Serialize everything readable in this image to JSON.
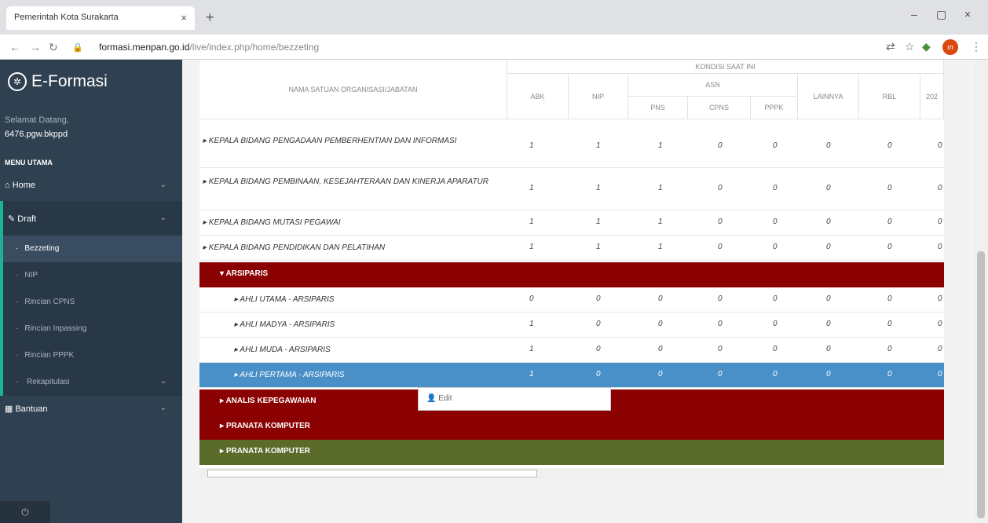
{
  "browser": {
    "tab_title": "Pemerintah Kota Surakarta",
    "tab_close": "×",
    "new_tab": "+",
    "minimize": "–",
    "maximize": "▢",
    "close": "×",
    "url_host": "formasi.menpan.go.id",
    "url_path": "/live/index.php/home/bezzeting",
    "profile_initial": "m"
  },
  "sidebar": {
    "brand": "E-Formasi",
    "welcome": "Selamat Datang,",
    "user": "6476.pgw.bkppd",
    "menu_header": "MENU UTAMA",
    "items": {
      "home": "Home",
      "draft": "Draft",
      "bantuan": "Bantuan"
    },
    "draft_subitems": [
      "Bezzeting",
      "NIP",
      "Rincian CPNS",
      "Rincian Inpassing",
      "Rincian PPPK",
      "Rekapitulasi"
    ]
  },
  "table": {
    "headers": {
      "name": "NAMA SATUAN ORGANISASI/JABATAN",
      "kondisi": "KONDISI SAAT INI",
      "abk": "ABK",
      "nip": "NIP",
      "asn": "ASN",
      "pns": "PNS",
      "cpns": "CPNS",
      "pppk": "PPPK",
      "lainnya": "LAINNYA",
      "rbl": "RBL",
      "next": "202"
    },
    "rows": [
      {
        "name": "▸ KEPALA BIDANG PENGADAAN PEMBERHENTIAN DAN INFORMASI",
        "values": [
          "1",
          "1",
          "1",
          "0",
          "0",
          "0",
          "0",
          "0"
        ]
      },
      {
        "name": "▸ KEPALA BIDANG PEMBINAAN, KESEJAHTERAAN DAN KINERJA APARATUR",
        "values": [
          "1",
          "1",
          "1",
          "0",
          "0",
          "0",
          "0",
          "0"
        ]
      },
      {
        "name": "▸ KEPALA BIDANG MUTASI PEGAWAI",
        "values": [
          "1",
          "1",
          "1",
          "0",
          "0",
          "0",
          "0",
          "0"
        ]
      },
      {
        "name": "▸ KEPALA BIDANG PENDIDIKAN DAN PELATIHAN",
        "values": [
          "1",
          "1",
          "1",
          "0",
          "0",
          "0",
          "0",
          "0"
        ]
      }
    ],
    "group_arsiparis": "ARSIPARIS",
    "arsiparis_rows": [
      {
        "name": "▸ AHLI UTAMA - ARSIPARIS",
        "values": [
          "0",
          "0",
          "0",
          "0",
          "0",
          "0",
          "0",
          "0"
        ]
      },
      {
        "name": "▸ AHLI MADYA - ARSIPARIS",
        "values": [
          "1",
          "0",
          "0",
          "0",
          "0",
          "0",
          "0",
          "0"
        ]
      },
      {
        "name": "▸ AHLI MUDA - ARSIPARIS",
        "values": [
          "1",
          "0",
          "0",
          "0",
          "0",
          "0",
          "0",
          "0"
        ]
      },
      {
        "name": "▸ AHLI PERTAMA - ARSIPARIS",
        "values": [
          "1",
          "0",
          "0",
          "0",
          "0",
          "0",
          "0",
          "0"
        ]
      }
    ],
    "groups_after": [
      {
        "name": "ANALIS KEPEGAWAIAN",
        "color": "#8b0000"
      },
      {
        "name": "PRANATA KOMPUTER",
        "color": "#8b0000"
      },
      {
        "name": "PRANATA KOMPUTER",
        "color": "#5a6b2a"
      }
    ]
  },
  "context_menu": {
    "edit": "Edit"
  },
  "colors": {
    "group_red": "#8b0000",
    "group_olive": "#5a6b2a",
    "selected": "#4a90c8",
    "sidebar": "#2f4050",
    "accent": "#1ab394"
  }
}
